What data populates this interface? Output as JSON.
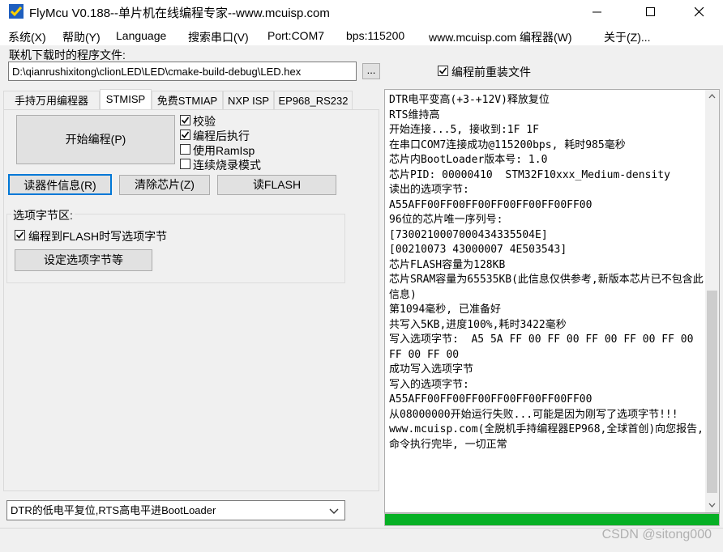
{
  "window": {
    "title": "FlyMcu V0.188--单片机在线编程专家--www.mcuisp.com",
    "minimize_glyph": "—",
    "maximize_glyph": "☐",
    "close_glyph": "✕"
  },
  "menu": {
    "items": [
      "系统(X)",
      "帮助(Y)",
      "Language",
      "搜索串口(V)",
      "Port:COM7",
      "bps:115200",
      "www.mcuisp.com 编程器(W)",
      "关于(Z)..."
    ]
  },
  "file": {
    "label": "联机下载时的程序文件:",
    "path": "D:\\qianrushixitong\\clionLED\\LED\\cmake-build-debug\\LED.hex",
    "browse_label": "...",
    "reload_label": "编程前重装文件",
    "reload_checked": true
  },
  "tabs": [
    "手持万用编程器",
    "STMISP",
    "免费STMIAP",
    "NXP ISP",
    "EP968_RS232"
  ],
  "active_tab": "STMISP",
  "stmisp": {
    "start_button": "开始编程(P)",
    "checks": [
      {
        "label": "校验",
        "checked": true
      },
      {
        "label": "编程后执行",
        "checked": true
      },
      {
        "label": "使用RamIsp",
        "checked": false
      },
      {
        "label": "连续烧录模式",
        "checked": false
      }
    ],
    "read_info_button": "读器件信息(R)",
    "clear_chip_button": "清除芯片(Z)",
    "read_flash_button": "读FLASH",
    "option_group_title": "选项字节区:",
    "option_write_label": "编程到FLASH时写选项字节",
    "option_write_checked": true,
    "set_option_button": "设定选项字节等"
  },
  "mode_select": {
    "value": "DTR的低电平复位,RTS高电平进BootLoader"
  },
  "log": {
    "lines": [
      "DTR电平变高(+3-+12V)释放复位",
      "RTS维持高",
      "开始连接...5, 接收到:1F 1F",
      "在串口COM7连接成功@115200bps, 耗时985毫秒",
      "芯片内BootLoader版本号: 1.0",
      "芯片PID: 00000410  STM32F10xxx_Medium-density",
      "读出的选项字节:",
      "A55AFF00FF00FF00FF00FF00FF00FF00",
      "96位的芯片唯一序列号:",
      "[7300210007000434335504E]",
      "[00210073 43000007 4E503543]",
      "芯片FLASH容量为128KB",
      "芯片SRAM容量为65535KB(此信息仅供参考,新版本芯片已不包含此信息)",
      "第1094毫秒, 已准备好",
      "共写入5KB,进度100%,耗时3422毫秒",
      "写入选项字节:  A5 5A FF 00 FF 00 FF 00 FF 00 FF 00 FF 00 FF 00",
      "成功写入选项字节",
      "写入的选项字节:",
      "A55AFF00FF00FF00FF00FF00FF00FF00",
      "从08000000开始运行失败...可能是因为刚写了选项字节!!!",
      "www.mcuisp.com(全脱机手持编程器EP968,全球首创)向您报告, 命令执行完毕, 一切正常"
    ]
  },
  "progress": {
    "percent": 100,
    "color": "#06b025"
  },
  "watermark": "CSDN @sitong000"
}
